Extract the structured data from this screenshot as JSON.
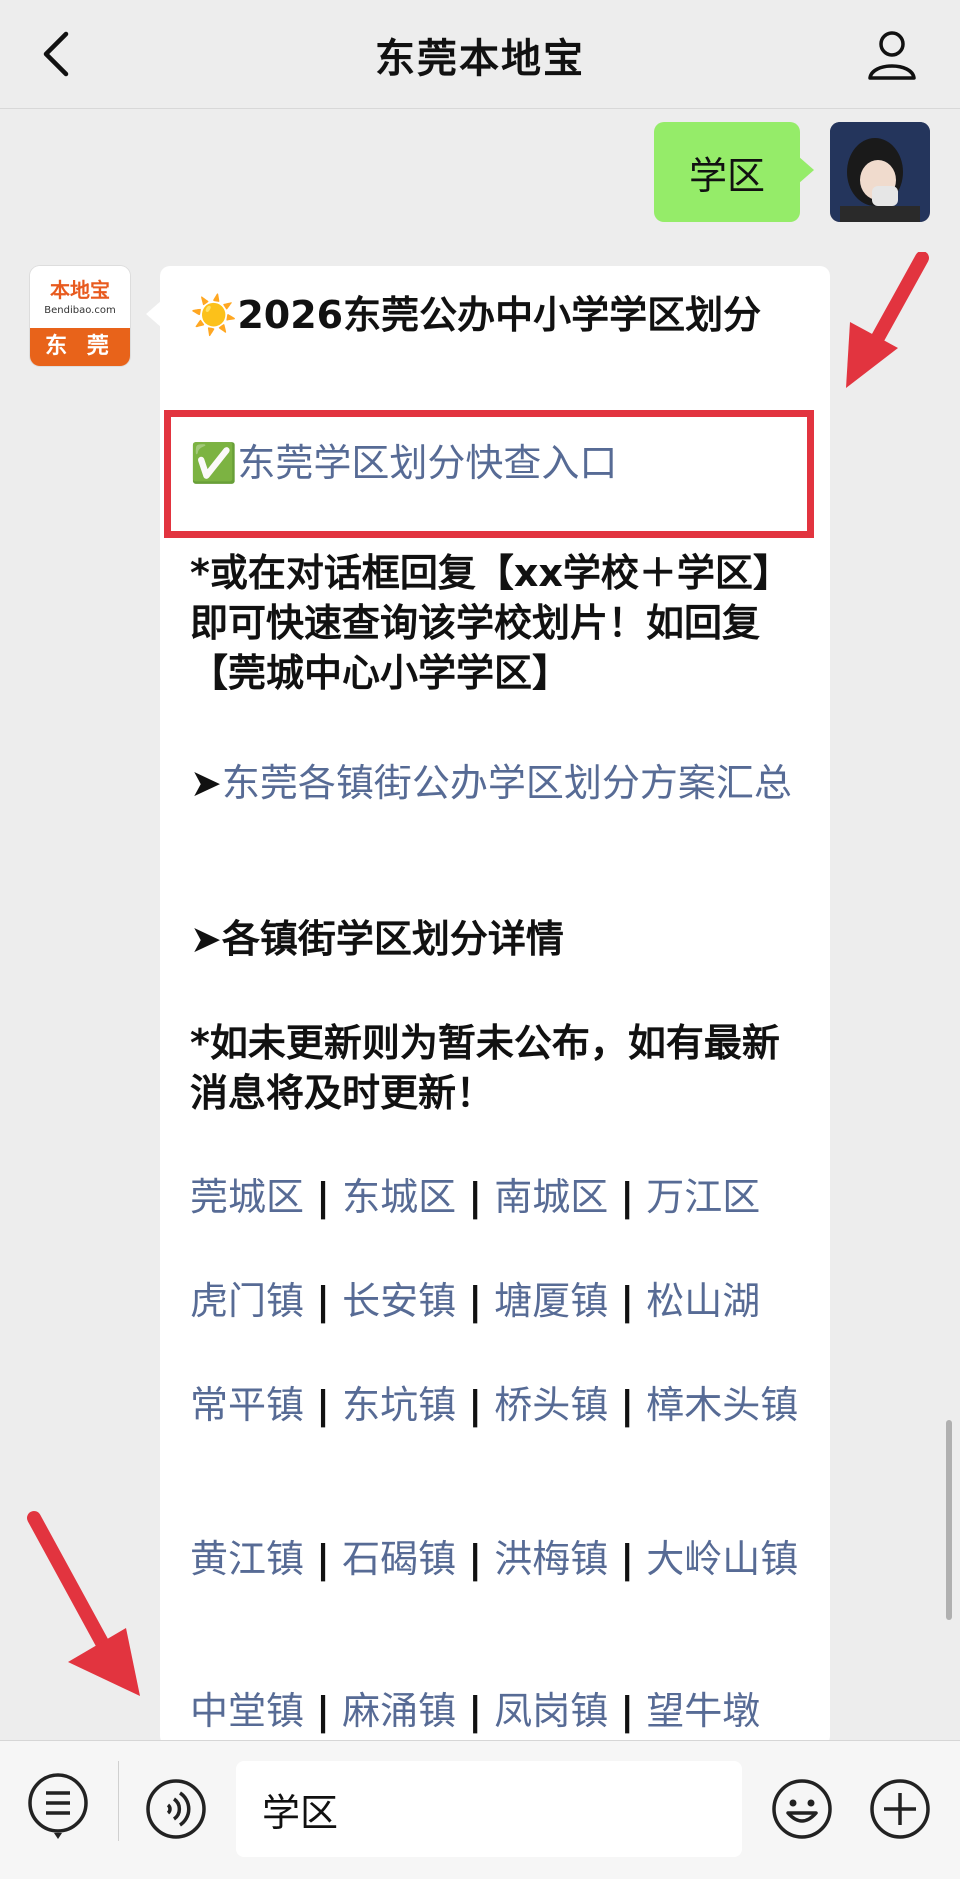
{
  "header": {
    "title": "东莞本地宝"
  },
  "user_message": {
    "text": "学区"
  },
  "bot_avatar": {
    "logo_text": "本地宝",
    "logo_sub": "Bendibao.com",
    "city": "东 莞"
  },
  "bot_message": {
    "title_emoji": "☀️",
    "title": "2026东莞公办中小学学区划分",
    "check_emoji": "✅",
    "quick_link": "东莞学区划分快查入口",
    "tip": "*或在对话框回复【xx学校＋学区】即可快速查询该学校划片！如回复【莞城中心小学学区】",
    "arrow1": "➤",
    "summary_link": "东莞各镇街公办学区划分方案汇总",
    "arrow2": "➤",
    "details_heading": "各镇街学区划分详情",
    "update_note": "*如未更新则为暂未公布，如有最新消息将及时更新！",
    "separator": "|",
    "areas": [
      [
        "莞城区",
        "东城区",
        "南城区",
        "万江区"
      ],
      [
        "虎门镇",
        "长安镇",
        "塘厦镇",
        "松山湖"
      ],
      [
        "常平镇",
        "东坑镇",
        "桥头镇",
        "樟木头镇"
      ],
      [
        "黄江镇",
        "石碣镇",
        "洪梅镇",
        "大岭山镇"
      ],
      [
        "中堂镇",
        "麻涌镇",
        "凤岗镇",
        "望牛墩"
      ]
    ]
  },
  "input": {
    "value": "学区"
  },
  "colors": {
    "user_bubble": "#95ec69",
    "link": "#576b95",
    "highlight": "#e2343f",
    "arrow": "#e2343f"
  },
  "icons": [
    "back-icon",
    "profile-icon",
    "menu-icon",
    "voice-icon",
    "emoji-icon",
    "plus-icon"
  ]
}
